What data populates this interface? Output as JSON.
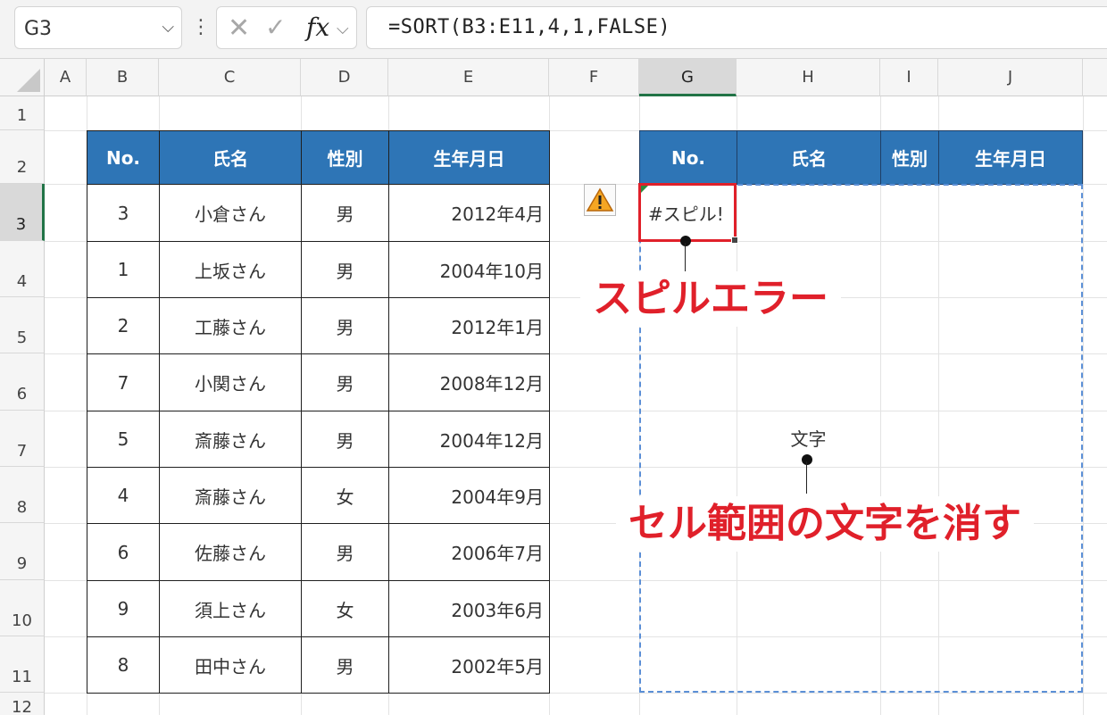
{
  "formula_bar": {
    "name_box": "G3",
    "formula": "=SORT(B3:E11,4,1,FALSE)",
    "fx_label": "fx"
  },
  "columns": [
    "A",
    "B",
    "C",
    "D",
    "E",
    "F",
    "G",
    "H",
    "I",
    "J"
  ],
  "selected_column": "G",
  "rows": [
    "1",
    "2",
    "3",
    "4",
    "5",
    "6",
    "7",
    "8",
    "9",
    "10",
    "11",
    "12"
  ],
  "selected_row": "3",
  "source_table": {
    "headers": [
      "No.",
      "氏名",
      "性別",
      "生年月日"
    ],
    "rows": [
      [
        "3",
        "小倉さん",
        "男",
        "2012年4月"
      ],
      [
        "1",
        "上坂さん",
        "男",
        "2004年10月"
      ],
      [
        "2",
        "工藤さん",
        "男",
        "2012年1月"
      ],
      [
        "7",
        "小関さん",
        "男",
        "2008年12月"
      ],
      [
        "5",
        "斎藤さん",
        "男",
        "2004年12月"
      ],
      [
        "4",
        "斎藤さん",
        "女",
        "2004年9月"
      ],
      [
        "6",
        "佐藤さん",
        "男",
        "2006年7月"
      ],
      [
        "9",
        "須上さん",
        "女",
        "2003年6月"
      ],
      [
        "8",
        "田中さん",
        "男",
        "2002年5月"
      ]
    ]
  },
  "result_table": {
    "headers": [
      "No.",
      "氏名",
      "性別",
      "生年月日"
    ],
    "error_value": "#スピル!",
    "blocking_text": "文字"
  },
  "annotations": {
    "spill_error": "スピルエラー",
    "clear_text": "セル範囲の文字を消す"
  },
  "colors": {
    "header_blue": "#2e75b6",
    "annotation_red": "#e0202a",
    "spill_border": "#5b8fd6",
    "selection_green": "#217346"
  }
}
